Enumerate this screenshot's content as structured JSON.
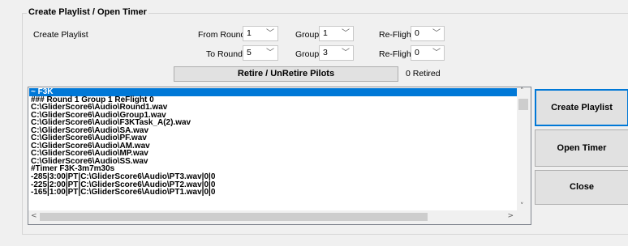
{
  "groupbox": {
    "title": "Create Playlist / Open Timer"
  },
  "create_playlist_label": "Create Playlist",
  "from_row": {
    "round_label": "From Round",
    "round_value": "1",
    "group_label": "Group",
    "group_value": "1",
    "reflight_label": "Re-Flight",
    "reflight_value": "0"
  },
  "to_row": {
    "round_label": "To Round",
    "round_value": "5",
    "group_label": "Group",
    "group_value": "3",
    "reflight_label": "Re-Flight",
    "reflight_value": "0"
  },
  "retire_button": "Retire / UnRetire Pilots",
  "retired_count": "0 Retired",
  "playlist_lines": [
    "~ F3K",
    "### Round 1   Group 1   ReFlight 0",
    "C:\\GliderScore6\\Audio\\Round1.wav",
    "C:\\GliderScore6\\Audio\\Group1.wav",
    "C:\\GliderScore6\\Audio\\F3KTask_A(2).wav",
    "C:\\GliderScore6\\Audio\\SA.wav",
    "C:\\GliderScore6\\Audio\\PF.wav",
    "C:\\GliderScore6\\Audio\\AM.wav",
    "C:\\GliderScore6\\Audio\\MP.wav",
    "C:\\GliderScore6\\Audio\\SS.wav",
    "#Timer F3K-3m7m30s",
    "-285|3:00|PT|C:\\GliderScore6\\Audio\\PT3.wav|0|0",
    "-225|2:00|PT|C:\\GliderScore6\\Audio\\PT2.wav|0|0",
    "-165|1:00|PT|C:\\GliderScore6\\Audio\\PT1.wav|0|0"
  ],
  "buttons": {
    "create_playlist": "Create Playlist",
    "open_timer": "Open Timer",
    "close": "Close"
  },
  "icons": {
    "dropdown": "chevron-down-icon",
    "scroll_up": "arrow-up-icon",
    "scroll_down": "arrow-down-icon",
    "scroll_left": "arrow-left-icon",
    "scroll_right": "arrow-right-icon"
  },
  "colors": {
    "selection": "#0078d7",
    "default_button_border": "#0078d7",
    "window_bg": "#f0f0f0"
  }
}
